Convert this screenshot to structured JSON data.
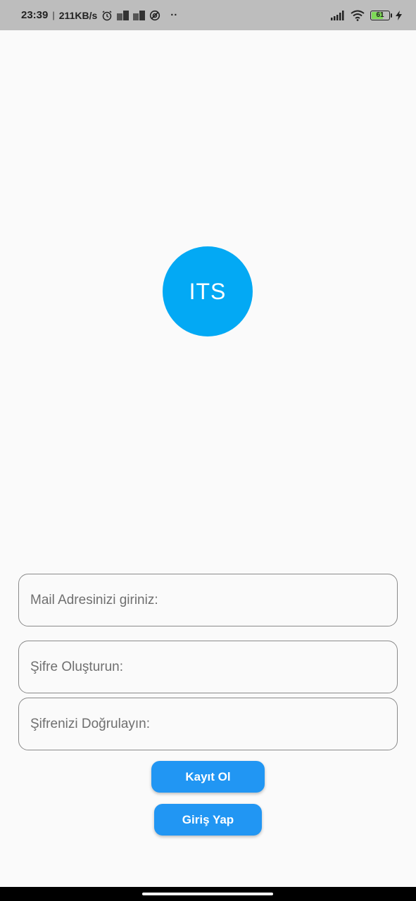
{
  "status_bar": {
    "time": "23:39",
    "separator": "|",
    "network_speed": "211KB/s",
    "icons": [
      "alarm-icon",
      "notification-icon",
      "notification-icon",
      "vpn-icon",
      "more-dots-icon"
    ],
    "right_icons": [
      "signal-icon",
      "wifi-icon",
      "battery-icon",
      "charging-icon"
    ],
    "battery_level": "61",
    "dots": "··"
  },
  "logo": {
    "text": "ITS",
    "color": "#03a9f4"
  },
  "form": {
    "email_placeholder": "Mail Adresinizi giriniz:",
    "password_placeholder": "Şifre Oluşturun:",
    "confirm_placeholder": "Şifrenizi Doğrulayın:"
  },
  "buttons": {
    "register_label": "Kayıt Ol",
    "login_label": "Giriş Yap",
    "color": "#2196f3"
  }
}
